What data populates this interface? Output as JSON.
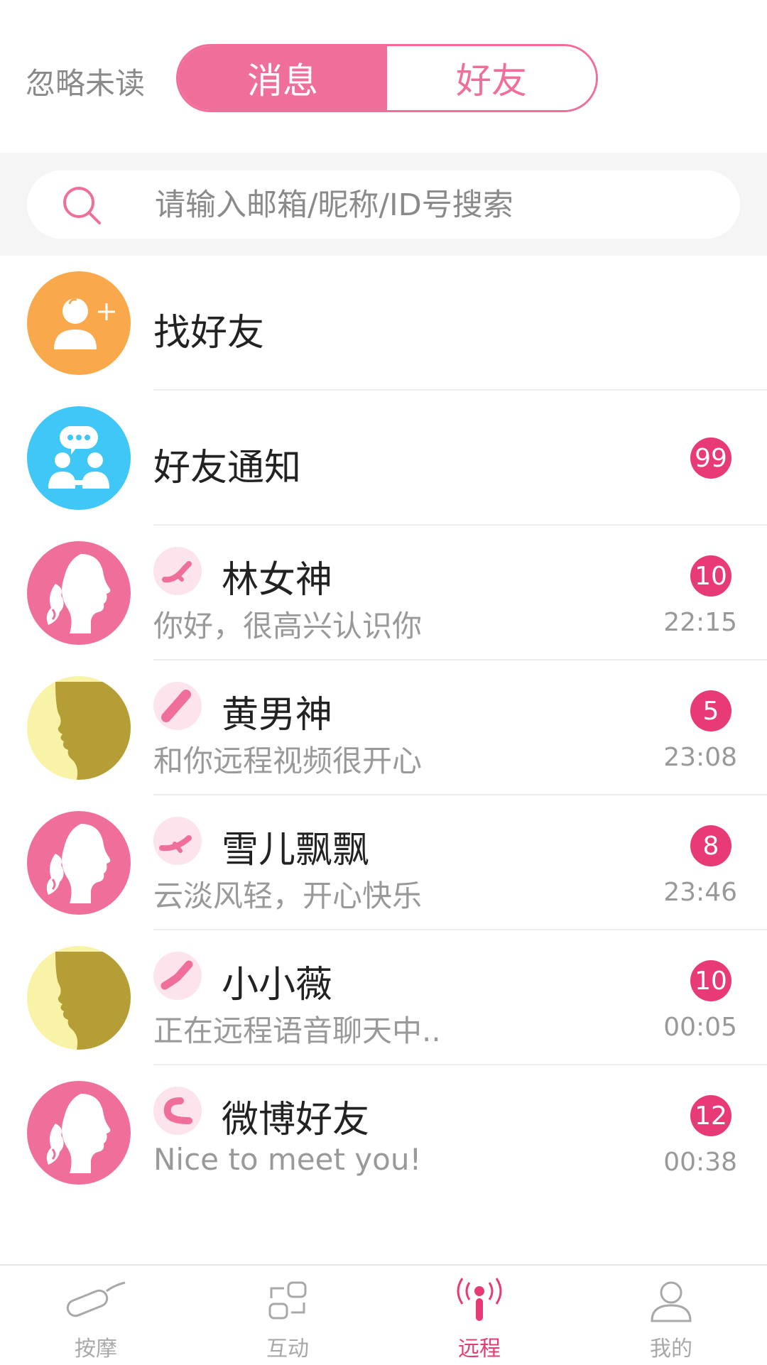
{
  "header": {
    "ignore_unread": "忽略未读",
    "tabs": [
      {
        "label": "消息",
        "active": true
      },
      {
        "label": "好友",
        "active": false
      }
    ]
  },
  "search": {
    "placeholder": "请输入邮箱/昵称/ID号搜索",
    "value": ""
  },
  "find_friends": {
    "label": "找好友",
    "icon": "add-user-icon"
  },
  "friend_notice": {
    "label": "好友通知",
    "badge": "99",
    "icon": "group-chat-icon"
  },
  "contacts": [
    {
      "name": "林女神",
      "message": "你好，很高兴认识你",
      "time": "22:15",
      "badge": "10",
      "avatar": "female-avatar",
      "toy": "rabbit-vibe-icon"
    },
    {
      "name": "黄男神",
      "message": "和你远程视频很开心",
      "time": "23:08",
      "badge": "5",
      "avatar": "male-avatar",
      "toy": "wand-icon"
    },
    {
      "name": "雪儿飘飘",
      "message": "云淡风轻，开心快乐",
      "time": "23:46",
      "badge": "8",
      "avatar": "female-avatar",
      "toy": "rabbit-vibe-icon"
    },
    {
      "name": "小小薇",
      "message": "正在远程语音聊天中..",
      "time": "00:05",
      "badge": "10",
      "avatar": "male-avatar",
      "toy": "curve-vibe-icon"
    },
    {
      "name": "微博好友",
      "message": "Nice to meet you!",
      "time": "00:38",
      "badge": "12",
      "avatar": "female-avatar",
      "toy": "u-shape-icon"
    }
  ],
  "tabbar": [
    {
      "label": "按摩",
      "icon": "massager-icon",
      "active": false
    },
    {
      "label": "互动",
      "icon": "interact-icon",
      "active": false
    },
    {
      "label": "远程",
      "icon": "remote-signal-icon",
      "active": true
    },
    {
      "label": "我的",
      "icon": "profile-icon",
      "active": false
    }
  ],
  "colors": {
    "accent": "#f06f9a",
    "badge": "#e73a76",
    "orange": "#f9a94b",
    "blue": "#3ec7f7",
    "olive": "#b59e35"
  }
}
